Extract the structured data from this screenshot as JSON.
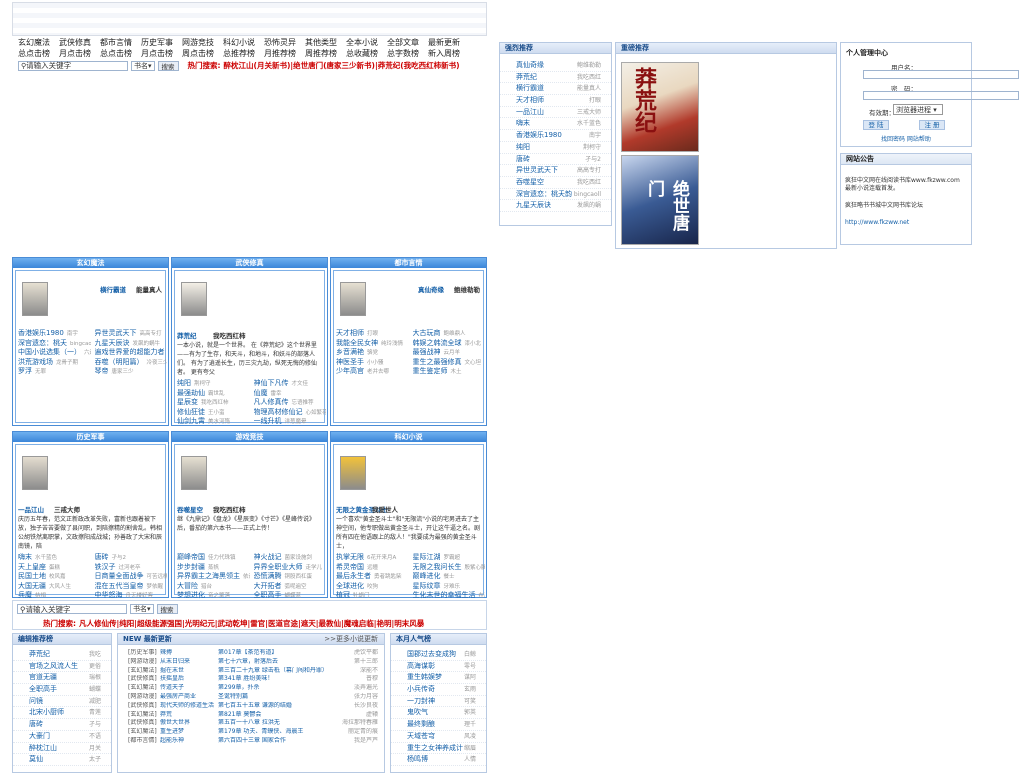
{
  "nav": {
    "row1": [
      "玄幻魔法",
      "武侠修真",
      "都市言情",
      "历史军事",
      "网游竞技",
      "科幻小说",
      "恐怖灵异",
      "其他类型",
      "全本小说",
      "全部文章",
      "最新更新"
    ],
    "row2": [
      "总点击榜",
      "月点击榜",
      "总点击榜",
      "月点击榜",
      "周点击榜",
      "总推荐榜",
      "月推荐榜",
      "周推荐榜",
      "总收藏榜",
      "总字数榜",
      "新入周榜"
    ]
  },
  "search_top": {
    "placeholder": "请输入关键字",
    "select": "书名",
    "button": "搜索",
    "hot_label": "热门搜索:",
    "hot_items": [
      "醉枕江山(月关新书)",
      "绝世唐门(唐家三少新书)",
      "莽荒纪(我吃西红柿新书)"
    ]
  },
  "rank_box": {
    "title": "强烈推荐",
    "items": [
      {
        "name": "真仙奇缘",
        "author": "鲍维勒勒"
      },
      {
        "name": "莽荒纪",
        "author": "我吃西红"
      },
      {
        "name": "横行霸道",
        "author": "能量真人"
      },
      {
        "name": "天才相师",
        "author": "打眼"
      },
      {
        "name": "一品江山",
        "author": "三戒大师"
      },
      {
        "name": "嗨末",
        "author": "水千蓝色"
      },
      {
        "name": "香港娱乐1980",
        "author": "南宇"
      },
      {
        "name": "纯阳",
        "author": "荆柯守"
      },
      {
        "name": "唐砖",
        "author": "孑与2"
      },
      {
        "name": "异世灵武天下",
        "author": "高高专打"
      },
      {
        "name": "吞噬星空",
        "author": "我吃西红"
      },
      {
        "name": "深宫遗恋：桃夭韵",
        "author": "bingcaoll"
      },
      {
        "name": "九星天辰诀",
        "author": "发飙的蜗"
      }
    ]
  },
  "cover_box": {
    "title": "重磅推荐",
    "cover1_text": "莽荒纪",
    "cover2_text": "绝世唐门"
  },
  "user_box": {
    "title": "个人管理中心",
    "user_label": "用户名：",
    "pass_label": "密　码：",
    "valid_label": "有效期：",
    "valid_value": "浏览器进程",
    "login": "登 陆",
    "register": "注 册",
    "links": "找回密码 网站帮助"
  },
  "notice_box": {
    "title": "网站公告",
    "line1": "疯狂中文网在线阅读书库www.fkzww.com 最新小说连载首发。",
    "line2": "疯狂略书书城中文网书库论坛",
    "line3": "http://www.fkzww.net"
  },
  "categories": [
    {
      "title": "玄幻魔法",
      "book": "横行霸道",
      "author": "能量真人",
      "desc": "",
      "list": [
        [
          "香港娱乐1980",
          "南宇"
        ],
        [
          "异世灵武天下",
          "高高专打"
        ],
        [
          "深宫遗恋：桃夭",
          "bingcaoll"
        ],
        [
          "九星天辰诀",
          "发飙的蜗牛"
        ],
        [
          "中国小说选集（一）",
          "六边"
        ],
        [
          "遍戏世界爱的超能力者",
          "遊手"
        ],
        [
          "洪荒游戏场",
          "龙骨子期"
        ],
        [
          "吞噬（明阳篇）",
          "冷夜三少"
        ],
        [
          "罗浮",
          "无罪"
        ],
        [
          "琴帝",
          "唐家三少"
        ]
      ]
    },
    {
      "title": "武侠修真",
      "book": "莽荒纪",
      "author": "我吃西红柿",
      "desc": "一本小说，就是一个世界。 在《莽荒纪》这个世界里——有为了生存，和天斗，和地斗，和妖斗的部落人们。 有为了逍遥长生，历三灾九劫，纵死无悔的修仙者。 更有夸父",
      "list": [
        [
          "纯阳",
          "荆柯守"
        ],
        [
          "神仙下凡传",
          "才文佳"
        ],
        [
          "最强劫仙",
          "霸世乱"
        ],
        [
          "仙魔",
          "雷幸"
        ],
        [
          "星辰变",
          "我吃西红柿"
        ],
        [
          "凡人修真传",
          "忘语推荐"
        ],
        [
          "修仙狂徒",
          "王小蛮"
        ],
        [
          "物理高材修仙记",
          "心如繁花"
        ],
        [
          "仙剑九霄",
          "美水河殇"
        ],
        [
          "一线升机",
          "洋葱魔晕"
        ]
      ]
    },
    {
      "title": "都市言情",
      "book": "真仙奇缘",
      "author": "鲍维勒勒",
      "desc": "",
      "list": [
        [
          "天才相师",
          "打眼"
        ],
        [
          "大古玩商",
          "鲍维鼎人"
        ],
        [
          "我能全民女神",
          "纯玲浅情"
        ],
        [
          "韩娱之韩流全球",
          "漆小北"
        ],
        [
          "乡音满艳",
          "骆党"
        ],
        [
          "最强战神",
          "云月羊"
        ],
        [
          "神医圣手",
          "小小骚"
        ],
        [
          "重生之最强修真",
          "文心坦"
        ],
        [
          "少年高官",
          "老并去哪"
        ],
        [
          "重生鉴定师",
          "木土"
        ]
      ]
    },
    {
      "title": "历史军事",
      "book": "一品江山",
      "author": "三戒大师",
      "desc": "庆历五年春，范文正新政改革失败，富新也跟着被下放，独子苦苦要做了县问职，到陪擦精的割舍乱。韩相公胡铁然离职掌，文政擦阳成战城；孙善政了大宋和辰南镜，陪",
      "list": [
        [
          "嗨末",
          "水千蓝色"
        ],
        [
          "唐砖",
          "孑与2"
        ],
        [
          "天上皇座",
          "蛋糕"
        ],
        [
          "铁汉子",
          "过河老卒"
        ],
        [
          "民国土地",
          "校风嘉"
        ],
        [
          "日商量全面战争",
          "可苦远柳"
        ],
        [
          "大国无疆",
          "大风人生"
        ],
        [
          "混在五代当皇帝",
          "梦依醒"
        ],
        [
          "兵魔",
          "枯相"
        ],
        [
          "中华怒海",
          "舟无楼好客"
        ]
      ]
    },
    {
      "title": "游戏竞技",
      "book": "吞噬星空",
      "author": "我吃西红柿",
      "desc": "继《九鼎记》《盘龙》《星辰变》《寸芒》《星峰传说》后，番茄的第六本书——正式上传！",
      "list": [
        [
          "巅峰帝国",
          "佳力代珠镇"
        ],
        [
          "神火战记",
          "菌家设施剑"
        ],
        [
          "步步封疆",
          "蒸帆"
        ],
        [
          "异界全职业大师",
          "走学儿"
        ],
        [
          "异界霸主之海黑领主",
          "依请"
        ],
        [
          "恐慌满腾",
          "铜股西杠蛋"
        ],
        [
          "大冒险",
          "猎台"
        ],
        [
          "大开拓者",
          "弧呢遍空"
        ],
        [
          "梦想进化",
          "帝之擎落"
        ],
        [
          "全职高手",
          "蝴蝶蓝"
        ]
      ]
    },
    {
      "title": "科幻小说",
      "book": "无限之黄金圣斗士",
      "author": "我爱世人",
      "desc": "一个喜欢\"黄金圣斗士\"和\"无限流\"小说的宅男进去了主神空间，他专职做出黄金圣斗士，开让这牛逼之名。剧所有四在他语跟上的敌人！\"我要成为最强的黄金圣斗士，",
      "list": [
        [
          "执掌无限",
          "6花开来月A"
        ],
        [
          "星际江湖",
          "罗霸超"
        ],
        [
          "希灵帝国",
          "远瞳"
        ],
        [
          "无限之我问长生",
          "殷紫心脑"
        ],
        [
          "最后永生者",
          "勇者跳匙柴"
        ],
        [
          "巅峰进化",
          "餐士"
        ],
        [
          "全球进化",
          "咬狗"
        ],
        [
          "星际纹章",
          "牙难乐"
        ],
        [
          "植冠",
          "牡蛎门"
        ],
        [
          "生化末世的幸福生活",
          "在森"
        ]
      ]
    }
  ],
  "search_bottom": {
    "placeholder": "请输入关键字",
    "select": "书名",
    "button": "搜索",
    "hot_label": "热门搜索:",
    "hot_items": [
      "凡人修仙传",
      "纯阳",
      "超级能源强国",
      "光明纪元",
      "武动乾坤",
      "雷官",
      "医道官途",
      "遮天",
      "最教仙",
      "魔魂启临",
      "艳明",
      "明末风暴"
    ]
  },
  "editor_box": {
    "title": "编辑推荐榜",
    "items": [
      {
        "name": "莽荒纪",
        "author": "我吃"
      },
      {
        "name": "官场之风流人生",
        "author": "更俗"
      },
      {
        "name": "官道无疆",
        "author": "瑞根"
      },
      {
        "name": "全职高手",
        "author": "蝴蝶"
      },
      {
        "name": "问镜",
        "author": "减肥"
      },
      {
        "name": "北宋小厨师",
        "author": "青莲"
      },
      {
        "name": "唐砖",
        "author": "孑与"
      },
      {
        "name": "大豪门",
        "author": "不语"
      },
      {
        "name": "醉枕江山",
        "author": "月关"
      },
      {
        "name": "莫仙",
        "author": "太子"
      }
    ]
  },
  "update_box": {
    "title": "NEW 最新更新",
    "more": ">>更多小说更新",
    "rows": [
      [
        "[历史军事]",
        "辣搏",
        "第017章【茶范有道】",
        "虎饮平都"
      ],
      [
        "[网游动漫]",
        "从末日归来",
        "第七十六章，射落后去",
        "第十三郎"
      ],
      [
        "[玄幻魔法]",
        "掘在末世",
        "第三百二十九章 绿击柢（幕门闯和丹罪）",
        "深能不"
      ],
      [
        "[武侠修真]",
        "扶摇皇后",
        "第341章 胜纷美味！",
        "普穆"
      ],
      [
        "[玄幻魔法]",
        "传道天子",
        "第299章，扑杀",
        "淡弄遍光"
      ],
      [
        "[网游动漫]",
        "最强房产商业",
        "圣诞特别篇",
        "张力月容"
      ],
      [
        "[武侠修真]",
        "现代天师的修道生活",
        "第七百五十五章 谦源的结婚",
        "长沙良夜"
      ],
      [
        "[玄幻魔法]",
        "莽荒",
        "第821章 莫鬱会",
        "虚辕"
      ],
      [
        "[武侠修真]",
        "傲世大世界",
        "第五百一十八章 拉洪无",
        "海拉那特春雁"
      ],
      [
        "[玄幻魔法]",
        "重生进梦",
        "第179章 功夫、青蟆侠、海晨王",
        "丽定青的痕"
      ],
      [
        "[都市言情]",
        "超能乐神",
        "第六百四十三章 国家合作",
        "我是芦芦"
      ]
    ]
  },
  "month_box": {
    "title": "本月人气榜",
    "items": [
      {
        "name": "国郡过去变成狗",
        "author": "白鲸"
      },
      {
        "name": "高海谋彰",
        "author": "零号"
      },
      {
        "name": "重生韩娱梦",
        "author": "谋阿"
      },
      {
        "name": "小兵传奇",
        "author": "玄雨"
      },
      {
        "name": "一刀封神",
        "author": "可笑"
      },
      {
        "name": "鬼吹气",
        "author": "郭英"
      },
      {
        "name": "最终剩酿",
        "author": "理千"
      },
      {
        "name": "天域苍穹",
        "author": "风凌"
      },
      {
        "name": "重生之女神养成计",
        "author": "缩眉"
      },
      {
        "name": "杨鸣博",
        "author": "人情"
      }
    ]
  }
}
